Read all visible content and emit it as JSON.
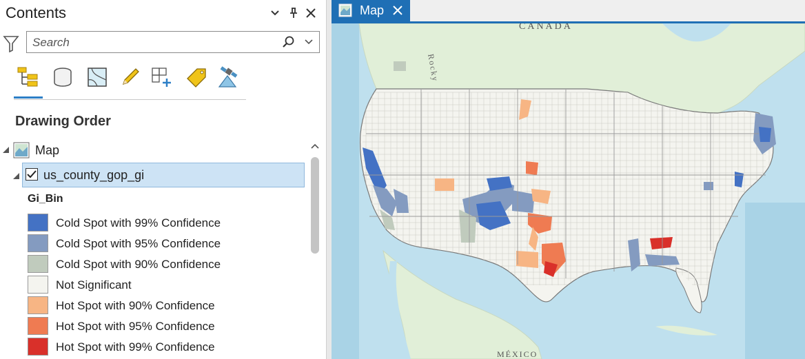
{
  "contents_pane": {
    "title": "Contents",
    "search_placeholder": "Search",
    "toolbar": [
      {
        "name": "list-by-drawing-order",
        "icon": "drawing-order-icon"
      },
      {
        "name": "list-by-data-source",
        "icon": "database-icon"
      },
      {
        "name": "list-by-selection",
        "icon": "selection-icon"
      },
      {
        "name": "list-by-editing",
        "icon": "pencil-icon"
      },
      {
        "name": "list-by-snapping",
        "icon": "snapping-icon"
      },
      {
        "name": "list-by-labeling",
        "icon": "label-tag-icon"
      },
      {
        "name": "list-by-perspective-imagery",
        "icon": "satellite-icon"
      }
    ],
    "section_title": "Drawing Order",
    "map_node": "Map",
    "layer": {
      "name": "us_county_gop_gi",
      "checked": true
    },
    "field": "Gi_Bin",
    "legend": [
      {
        "label": "Cold Spot with 99% Confidence",
        "color": "#4472c4"
      },
      {
        "label": "Cold Spot with 95% Confidence",
        "color": "#849bc0"
      },
      {
        "label": "Cold Spot with 90% Confidence",
        "color": "#c0cbbd"
      },
      {
        "label": "Not Significant",
        "color": "#f4f4ef"
      },
      {
        "label": "Hot Spot with 90% Confidence",
        "color": "#f7b584"
      },
      {
        "label": "Hot Spot with 95% Confidence",
        "color": "#ef7b52"
      },
      {
        "label": "Hot Spot with 99% Confidence",
        "color": "#d9302a"
      }
    ]
  },
  "map_view": {
    "tab_label": "Map",
    "labels": {
      "canada": "CANADA",
      "rocky": "Rocky",
      "mexico": "MÉXICO"
    }
  },
  "colors": {
    "accent": "#1f6fb5",
    "ocean": "#bfe0ee",
    "land_canada": "#e1efd8",
    "land_us": "#f4f4ef"
  }
}
